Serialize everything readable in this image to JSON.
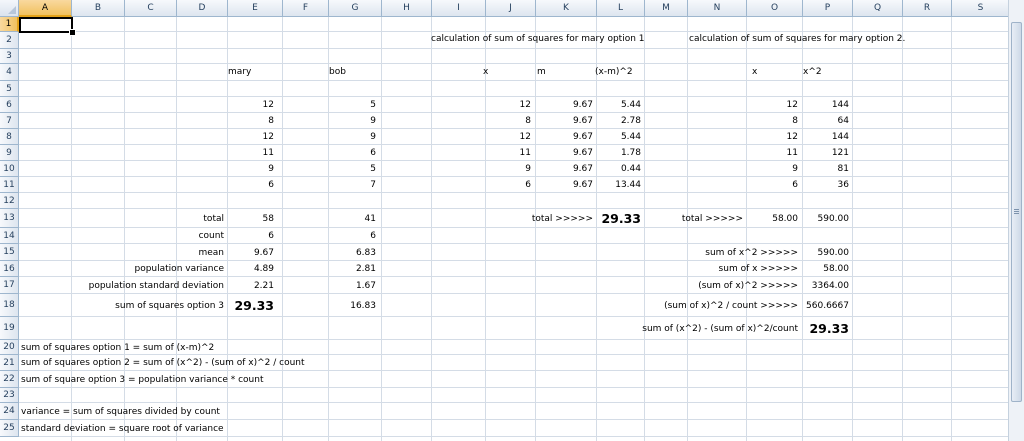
{
  "columns": [
    "A",
    "B",
    "C",
    "D",
    "E",
    "F",
    "G",
    "H",
    "I",
    "J",
    "K",
    "L",
    "M",
    "N",
    "O",
    "P",
    "Q",
    "R",
    "S"
  ],
  "rows": [
    "1",
    "2",
    "3",
    "4",
    "5",
    "6",
    "7",
    "8",
    "9",
    "10",
    "11",
    "12",
    "13",
    "14",
    "15",
    "16",
    "17",
    "18",
    "19",
    "20",
    "21",
    "22",
    "23",
    "24",
    "25"
  ],
  "selected_cell": "A1",
  "headers": {
    "mary": "mary",
    "bob": "bob",
    "opt1_title": "calculation of sum of squares for mary option 1",
    "opt2_title": "calculation of sum of squares for mary option 2.",
    "x": "x",
    "m": "m",
    "xm2": "(x-m)^2",
    "x2": "x",
    "x2sq": "x^2"
  },
  "data_rows": [
    {
      "mary": "12",
      "bob": "5",
      "x": "12",
      "m": "9.67",
      "xm2": "5.44",
      "x2": "12",
      "xsq": "144"
    },
    {
      "mary": "8",
      "bob": "9",
      "x": "8",
      "m": "9.67",
      "xm2": "2.78",
      "x2": "8",
      "xsq": "64"
    },
    {
      "mary": "12",
      "bob": "9",
      "x": "12",
      "m": "9.67",
      "xm2": "5.44",
      "x2": "12",
      "xsq": "144"
    },
    {
      "mary": "11",
      "bob": "6",
      "x": "11",
      "m": "9.67",
      "xm2": "1.78",
      "x2": "11",
      "xsq": "121"
    },
    {
      "mary": "9",
      "bob": "5",
      "x": "9",
      "m": "9.67",
      "xm2": "0.44",
      "x2": "9",
      "xsq": "81"
    },
    {
      "mary": "6",
      "bob": "7",
      "x": "6",
      "m": "9.67",
      "xm2": "13.44",
      "x2": "6",
      "xsq": "36"
    }
  ],
  "stats": [
    {
      "label": "total",
      "mary": "58",
      "bob": "41"
    },
    {
      "label": "count",
      "mary": "6",
      "bob": "6"
    },
    {
      "label": "mean",
      "mary": "9.67",
      "bob": "6.83"
    },
    {
      "label": "population variance",
      "mary": "4.89",
      "bob": "2.81"
    },
    {
      "label": "population standard deviation",
      "mary": "2.21",
      "bob": "1.67"
    },
    {
      "label": "sum of squares option 3",
      "mary": "29.33",
      "bob": "16.83"
    }
  ],
  "opt1_total": {
    "label": "total >>>>>",
    "value": "29.33"
  },
  "opt2_total": {
    "label": "total >>>>>",
    "x": "58.00",
    "xsq": "590.00"
  },
  "opt2_calc": [
    {
      "label": "sum of x^2 >>>>>",
      "value": "590.00"
    },
    {
      "label": "sum of x >>>>>",
      "value": "58.00"
    },
    {
      "label": "(sum of x)^2 >>>>>",
      "value": "3364.00"
    },
    {
      "label": "(sum of x)^2 / count >>>>>",
      "value": "560.6667"
    },
    {
      "label": "sum of (x^2) - (sum of x)^2/count",
      "value": "29.33"
    }
  ],
  "notes": [
    "sum of squares option 1 = sum of (x-m)^2",
    "sum of squares option 2 = sum of (x^2) - (sum of x)^2 / count",
    "sum of square option 3 = population variance * count",
    "",
    "variance = sum of squares divided by count",
    "standard deviation = square root of variance"
  ]
}
